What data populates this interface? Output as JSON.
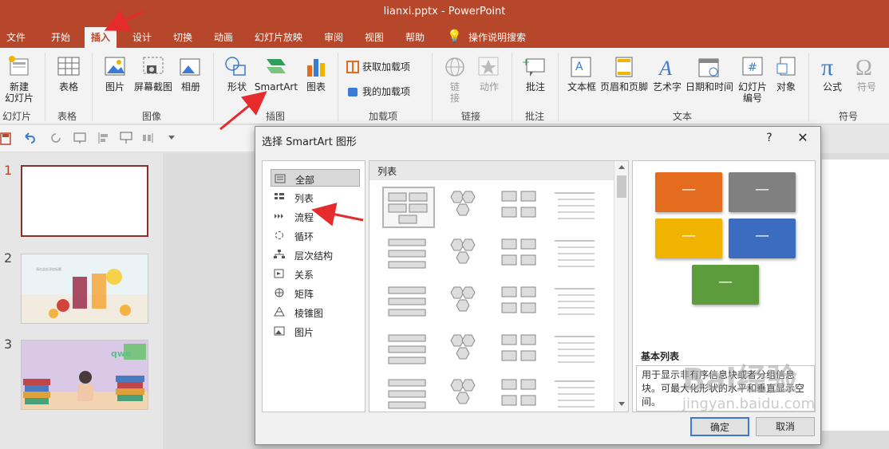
{
  "window": {
    "title": "lianxi.pptx  -  PowerPoint"
  },
  "tabs": [
    {
      "label": "文件"
    },
    {
      "label": "开始"
    },
    {
      "label": "插入"
    },
    {
      "label": "设计"
    },
    {
      "label": "切换"
    },
    {
      "label": "动画"
    },
    {
      "label": "幻灯片放映"
    },
    {
      "label": "审阅"
    },
    {
      "label": "视图"
    },
    {
      "label": "帮助"
    },
    {
      "label": "操作说明搜索"
    }
  ],
  "ribbon": {
    "new_slide": "新建\n幻灯片",
    "table": "表格",
    "picture": "图片",
    "screenshot": "屏幕截图",
    "album": "相册",
    "shapes": "形状",
    "smartart": "SmartArt",
    "chart": "图表",
    "get_addins": "获取加载项",
    "my_addins": "我的加载项",
    "link": "链\n接",
    "action": "动作",
    "comment": "批注",
    "textbox": "文本框",
    "header_footer": "页眉和页脚",
    "wordart": "艺术字",
    "datetime": "日期和时间",
    "slide_number": "幻灯片\n编号",
    "object": "对象",
    "equation": "公式",
    "symbol": "符号",
    "groups": {
      "slides": "幻灯片",
      "tables": "表格",
      "images": "图像",
      "illustrations": "插图",
      "addins": "加载项",
      "links": "链接",
      "comments": "批注",
      "text": "文本",
      "symbols": "符号"
    }
  },
  "slides": [
    {
      "num": "1"
    },
    {
      "num": "2"
    },
    {
      "num": "3"
    }
  ],
  "thumbnail_text": {
    "slide2": "请在此处添加标题",
    "slide3": "qwe"
  },
  "dialog": {
    "title": "选择 SmartArt 图形",
    "help": "?",
    "close": "✕",
    "categories": [
      {
        "label": "全部",
        "icon": "all-icon"
      },
      {
        "label": "列表",
        "icon": "list-icon"
      },
      {
        "label": "流程",
        "icon": "process-icon"
      },
      {
        "label": "循环",
        "icon": "cycle-icon"
      },
      {
        "label": "层次结构",
        "icon": "hierarchy-icon"
      },
      {
        "label": "关系",
        "icon": "relationship-icon"
      },
      {
        "label": "矩阵",
        "icon": "matrix-icon"
      },
      {
        "label": "棱锥图",
        "icon": "pyramid-icon"
      },
      {
        "label": "图片",
        "icon": "picture-icon"
      }
    ],
    "grid_header": "列表",
    "preview": {
      "title": "基本列表",
      "description": "用于显示非有序信息块或者分组信息块。可最大化形状的水平和垂直显示空间。",
      "box_colors": [
        "#e36c1f",
        "#808080",
        "#f0b400",
        "#3c6cc0",
        "#5c9c3c"
      ]
    },
    "ok": "确定",
    "cancel": "取消"
  },
  "watermark": "Bai经验",
  "watermark_url": "jingyan.baidu.com"
}
